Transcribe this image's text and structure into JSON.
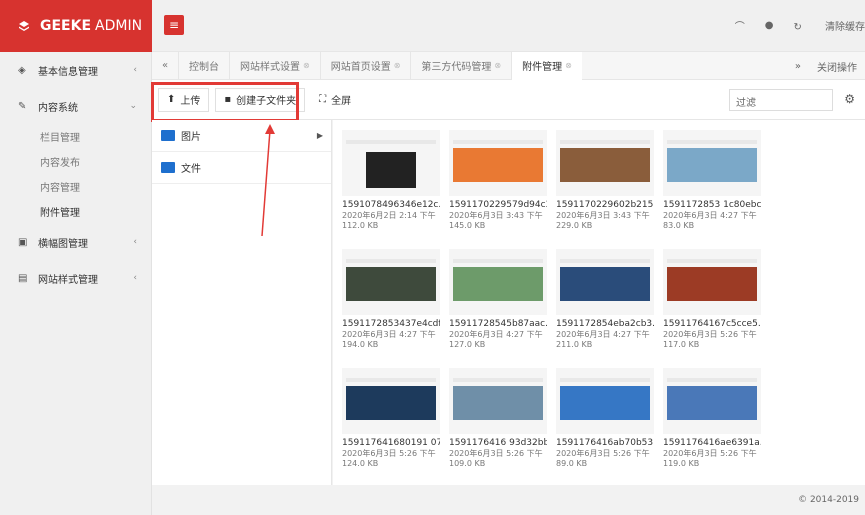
{
  "brand": {
    "bold": "GEEKE",
    "rest": "ADMIN"
  },
  "header": {
    "menu_icon": "menu-icon",
    "clear_cache": "清除缓存"
  },
  "sidebar": {
    "groups": [
      {
        "label": "基本信息管理",
        "icon": "info"
      },
      {
        "label": "内容系统",
        "icon": "edit",
        "subitems": [
          "栏目管理",
          "内容发布",
          "内容管理",
          "附件管理"
        ]
      },
      {
        "label": "横幅图管理",
        "icon": "image"
      },
      {
        "label": "网站样式管理",
        "icon": "style"
      }
    ]
  },
  "tabs": [
    "控制台",
    "网站样式设置",
    "网站首页设置",
    "第三方代码管理",
    "附件管理"
  ],
  "tabbar_right": "关闭操作",
  "toolbar": {
    "upload": "上传",
    "new_folder": "创建子文件夹",
    "fullscreen": "全屏",
    "filter_placeholder": "过滤"
  },
  "folders": [
    "图片",
    "文件"
  ],
  "files": [
    {
      "name": "1591078496346e12c...",
      "date": "2020年6月2日 2:14 下午",
      "size": "112.0 KB",
      "color": "#ffffff"
    },
    {
      "name": "1591170229579d94c3...",
      "date": "2020年6月3日 3:43 下午",
      "size": "145.0 KB",
      "color": "#e97933"
    },
    {
      "name": "1591170229602b215...",
      "date": "2020年6月3日 3:43 下午",
      "size": "229.0 KB",
      "color": "#8a5d3b"
    },
    {
      "name": "1591172853 1c80ebc...",
      "date": "2020年6月3日 4:27 下午",
      "size": "83.0 KB",
      "color": "#7ba8c8"
    },
    {
      "name": "1591172853437e4cdf...",
      "date": "2020年6月3日 4:27 下午",
      "size": "194.0 KB",
      "color": "#3e4a3c"
    },
    {
      "name": "15911728545b87aac...",
      "date": "2020年6月3日 4:27 下午",
      "size": "127.0 KB",
      "color": "#6d9b6a"
    },
    {
      "name": "1591172854eba2cb3...",
      "date": "2020年6月3日 4:27 下午",
      "size": "211.0 KB",
      "color": "#2a4c7a"
    },
    {
      "name": "15911764167c5cce5...",
      "date": "2020年6月3日 5:26 下午",
      "size": "117.0 KB",
      "color": "#9c3b25"
    },
    {
      "name": "159117641680191 07...",
      "date": "2020年6月3日 5:26 下午",
      "size": "124.0 KB",
      "color": "#1d3a5c"
    },
    {
      "name": "1591176416 93d32bbf...",
      "date": "2020年6月3日 5:26 下午",
      "size": "109.0 KB",
      "color": "#6f8fa8"
    },
    {
      "name": "1591176416ab70b53...",
      "date": "2020年6月3日 5:26 下午",
      "size": "89.0 KB",
      "color": "#3677c5"
    },
    {
      "name": "1591176416ae6391a...",
      "date": "2020年6月3日 5:26 下午",
      "size": "119.0 KB",
      "color": "#4a78b8"
    }
  ],
  "footer": "© 2014-2019",
  "colors": {
    "brand": "#d7332f",
    "highlight": "#e23a36"
  }
}
